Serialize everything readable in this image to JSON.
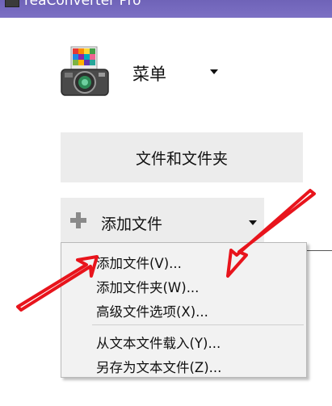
{
  "window": {
    "title": "reaConverter Pro"
  },
  "menu": {
    "label": "菜单"
  },
  "buttons": {
    "files_and_folders": "文件和文件夹",
    "add_files": "添加文件"
  },
  "dropdown": {
    "items": [
      "添加文件(V)...",
      "添加文件夹(W)...",
      "高级文件选项(X)...",
      "从文本文件载入(Y)...",
      "另存为文本文件(Z)..."
    ]
  },
  "colors": {
    "titlebar": "#7368bd",
    "button_bg": "#ececec",
    "menu_bg": "#f2f2f2",
    "annotation_arrow": "#e8141c"
  }
}
